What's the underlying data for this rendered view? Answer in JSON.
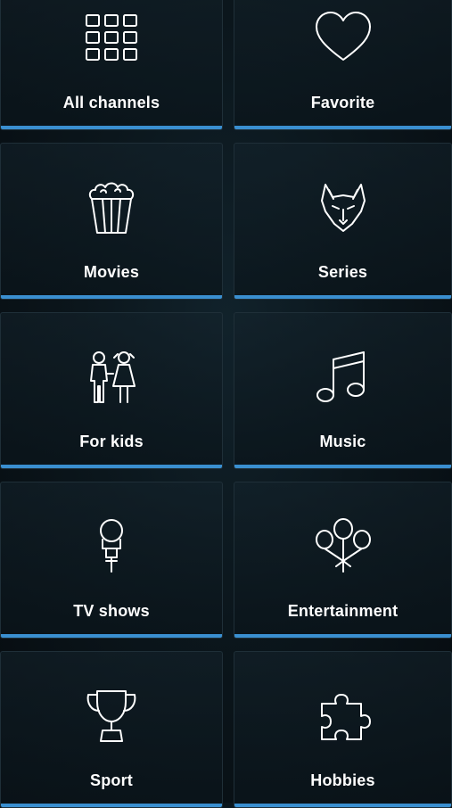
{
  "accent_color": "#3a8fd0",
  "categories": [
    {
      "label": "All channels",
      "icon": "grid-icon"
    },
    {
      "label": "Favorite",
      "icon": "heart-icon"
    },
    {
      "label": "Movies",
      "icon": "popcorn-icon"
    },
    {
      "label": "Series",
      "icon": "wolf-icon"
    },
    {
      "label": "For kids",
      "icon": "kids-icon"
    },
    {
      "label": "Music",
      "icon": "music-note-icon"
    },
    {
      "label": "TV shows",
      "icon": "microphone-icon"
    },
    {
      "label": "Entertainment",
      "icon": "balloons-icon"
    },
    {
      "label": "Sport",
      "icon": "trophy-icon"
    },
    {
      "label": "Hobbies",
      "icon": "puzzle-icon"
    }
  ]
}
